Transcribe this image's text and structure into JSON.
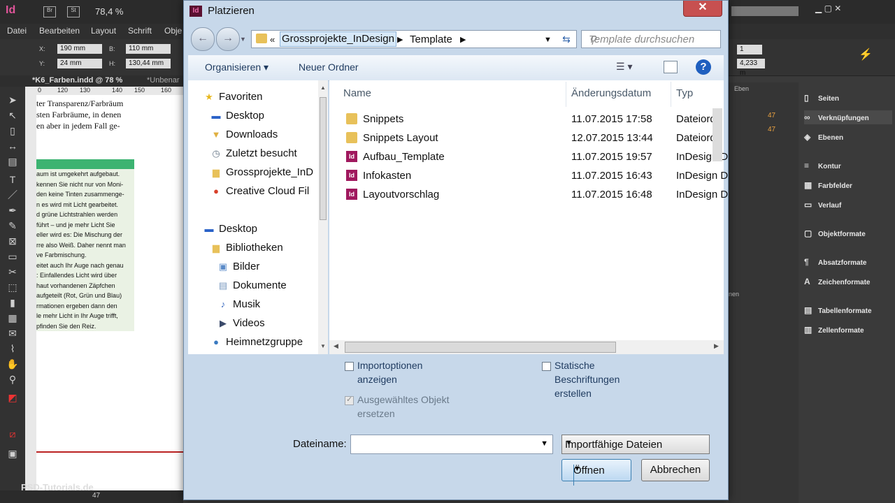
{
  "app": {
    "logo": "Id",
    "zoom": "78,4 %",
    "menu": [
      "Datei",
      "Bearbeiten",
      "Layout",
      "Schrift",
      "Obje"
    ],
    "control": {
      "x_label": "X:",
      "x_value": "190 mm",
      "y_label": "Y:",
      "y_value": "24 mm",
      "b_label": "B:",
      "b_value": "110 mm",
      "h_label": "H:",
      "h_value": "130,44 mm",
      "right_val1": "1",
      "right_val2": "4,233 m"
    },
    "doc_tab": "*K6_Farben.indd @ 78 %",
    "doc_tab2": "*Unbenar",
    "ruler_ticks": [
      "0",
      "120",
      "130",
      "140",
      "150",
      "160"
    ],
    "top_text": [
      "ter Transparenz/Farbräum",
      "sten Farbräume, in denen",
      "en aber in jedem Fall ge-"
    ],
    "frame_text": [
      "aum ist umgekehrt aufgebaut.",
      "kennen Sie nicht nur von Moni-",
      "den keine Tinten zusammenge-",
      "n es wird mit Licht gearbeitet.",
      "d grüne Lichtstrahlen werden",
      "führt – und je mehr Licht Sie",
      "eller wird es: Die Mischung der",
      "rre also Weiß. Daher nennt man",
      "ve Farbmischung.",
      "eitet auch Ihr Auge nach genau",
      ": Einfallendes Licht wird über",
      "haut vorhandenen Zäpfchen",
      "aufgeteilt (Rot, Grün und Blau)",
      "rmationen ergeben dann den",
      "le mehr Licht in Ihr Auge trifft,",
      "pfinden Sie den Reiz."
    ],
    "page_number": "47",
    "panel_header": "Eben",
    "panel_counts": [
      "47",
      "47"
    ],
    "panel_label2": "nen",
    "panels": [
      {
        "label": "Seiten",
        "icon": "▯"
      },
      {
        "label": "Verknüpfungen",
        "icon": "∞"
      },
      {
        "label": "Ebenen",
        "icon": "◈"
      },
      {
        "label": "Kontur",
        "icon": "≡"
      },
      {
        "label": "Farbfelder",
        "icon": "▦"
      },
      {
        "label": "Verlauf",
        "icon": "▭"
      },
      {
        "label": "Objektformate",
        "icon": "▢"
      },
      {
        "label": "Absatzformate",
        "icon": "¶"
      },
      {
        "label": "Zeichenformate",
        "icon": "A"
      },
      {
        "label": "Tabellenformate",
        "icon": "▤"
      },
      {
        "label": "Zellenformate",
        "icon": "▥"
      }
    ],
    "watermark": "PSD-Tutorials.de"
  },
  "dialog": {
    "title_icon": "Id",
    "title": "Platzieren",
    "close_glyph": "✕",
    "breadcrumb": {
      "prefix": "«",
      "items": [
        "Grossprojekte_InDesign",
        "Template"
      ]
    },
    "search_placeholder": "Template durchsuchen",
    "toolbar": {
      "organize": "Organisieren ▾",
      "new_folder": "Neuer Ordner",
      "help": "?"
    },
    "nav": [
      {
        "label": "Favoriten",
        "icon": "★",
        "color": "#e8b820"
      },
      {
        "label": "Desktop",
        "icon": "▬",
        "color": "#2a62c8"
      },
      {
        "label": "Downloads",
        "icon": "▼",
        "color": "#e0b040"
      },
      {
        "label": "Zuletzt besucht",
        "icon": "◷",
        "color": "#6a7a8a"
      },
      {
        "label": "Grossprojekte_InD",
        "icon": "▆",
        "color": "#e8c15a"
      },
      {
        "label": "Creative Cloud Fil",
        "icon": "●",
        "color": "#d8402a"
      },
      {
        "label": "Desktop",
        "icon": "▬",
        "color": "#2a62c8"
      },
      {
        "label": "Bibliotheken",
        "icon": "▆",
        "color": "#e8c15a"
      },
      {
        "label": "Bilder",
        "icon": "▣",
        "color": "#5a8ac8"
      },
      {
        "label": "Dokumente",
        "icon": "▤",
        "color": "#7a9ac0"
      },
      {
        "label": "Musik",
        "icon": "♪",
        "color": "#3a6ac0"
      },
      {
        "label": "Videos",
        "icon": "▶",
        "color": "#3a4a6a"
      },
      {
        "label": "Heimnetzgruppe",
        "icon": "●",
        "color": "#3a7ac0"
      }
    ],
    "columns": [
      "Name",
      "Änderungsdatum",
      "Typ"
    ],
    "files": [
      {
        "name": "Snippets",
        "date": "11.07.2015 17:58",
        "type": "Dateiordn",
        "kind": "folder"
      },
      {
        "name": "Snippets Layout",
        "date": "12.07.2015 13:44",
        "type": "Dateiordn",
        "kind": "folder"
      },
      {
        "name": "Aufbau_Template",
        "date": "11.07.2015 19:57",
        "type": "InDesign D",
        "kind": "id"
      },
      {
        "name": "Infokasten",
        "date": "11.07.2015 16:43",
        "type": "InDesign D",
        "kind": "id"
      },
      {
        "name": "Layoutvorschlag",
        "date": "11.07.2015 16:48",
        "type": "InDesign D",
        "kind": "id"
      }
    ],
    "options": {
      "import_options": "Importoptionen anzeigen",
      "replace_selected": "Ausgewähltes Objekt ersetzen",
      "static_captions": "Statische Beschriftungen erstellen"
    },
    "filename_label": "Dateiname:",
    "filename_value": "",
    "filter_value": "Importfähige Dateien",
    "open_label": "Öffnen",
    "cancel_label": "Abbrechen"
  }
}
